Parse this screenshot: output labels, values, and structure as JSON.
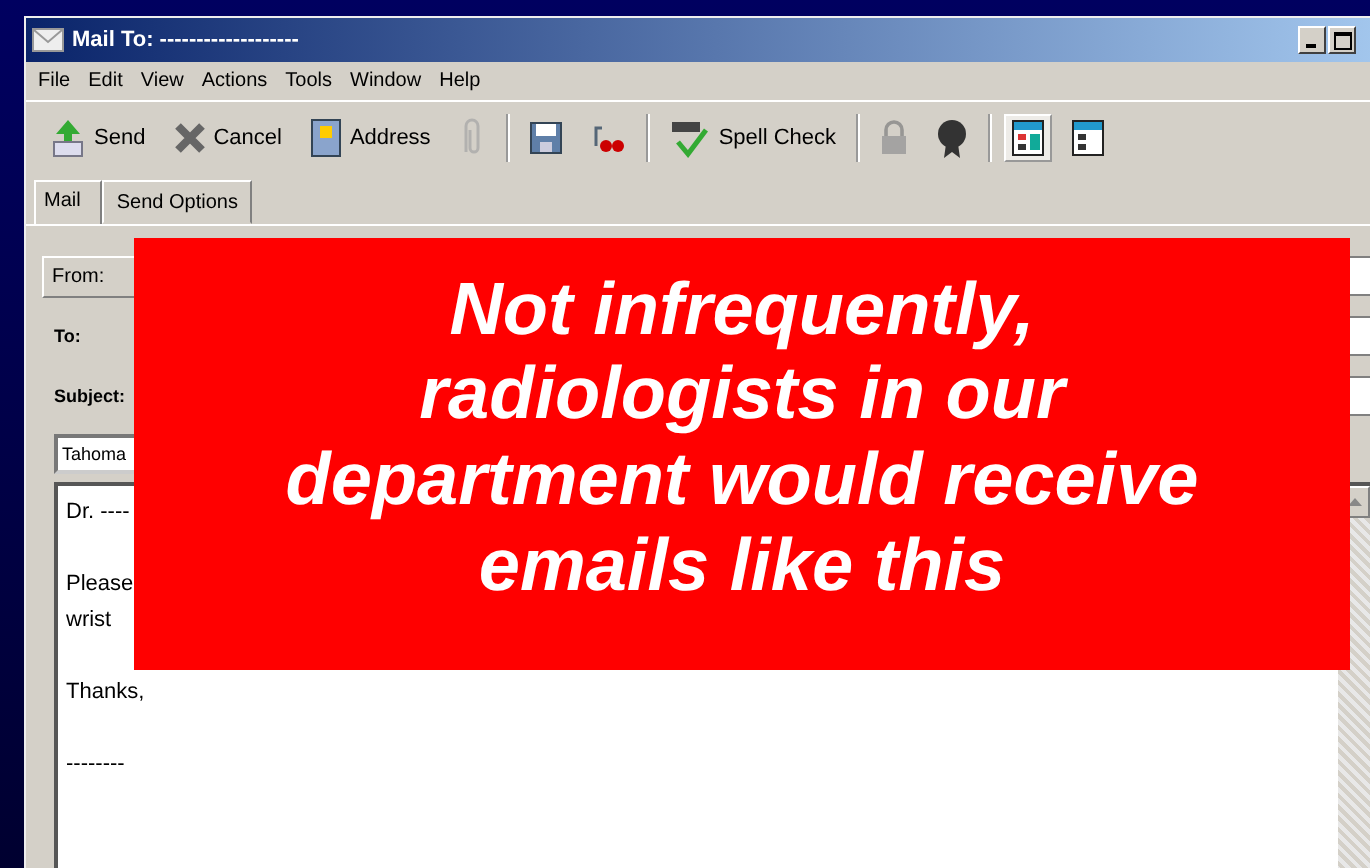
{
  "window": {
    "title": "Mail To: -------------------"
  },
  "menu": [
    "File",
    "Edit",
    "View",
    "Actions",
    "Tools",
    "Window",
    "Help"
  ],
  "toolbar": [
    {
      "label": "Send",
      "disabled": false,
      "selected": false
    },
    {
      "label": "Cancel",
      "disabled": false,
      "selected": false
    },
    {
      "label": "Address",
      "disabled": false,
      "selected": false
    },
    {
      "disabled": true,
      "selected": false
    },
    {
      "kind": "separator"
    },
    {
      "disabled": false,
      "selected": false
    },
    {
      "disabled": false,
      "selected": false
    },
    {
      "kind": "separator"
    },
    {
      "label": "Spell Check",
      "disabled": false,
      "selected": false
    },
    {
      "kind": "separator"
    },
    {
      "disabled": true,
      "selected": false
    },
    {
      "disabled": false,
      "selected": false
    },
    {
      "kind": "separator"
    },
    {
      "disabled": false,
      "selected": true
    },
    {
      "disabled": false,
      "selected": false
    }
  ],
  "tabs": [
    {
      "label": "Mail",
      "selected": true
    },
    {
      "label": "Send Options",
      "selected": false
    }
  ],
  "fields": {
    "from": "From:",
    "to": "To:",
    "subject": "Subject:"
  },
  "font": "Tahoma",
  "body": [
    [
      "Dr. ----"
    ],
    [
      "Please",
      "wrist"
    ],
    [
      "Thanks,"
    ],
    [
      "--------"
    ]
  ],
  "overlay": "Not infrequently, radiologists in our department would receive emails like this"
}
